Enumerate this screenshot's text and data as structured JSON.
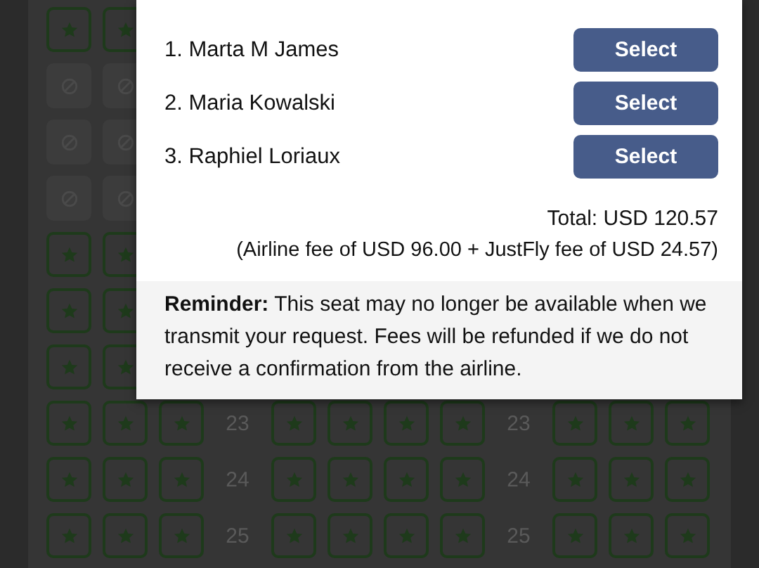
{
  "seat_rows": [
    {
      "available": true
    },
    {
      "available": false
    },
    {
      "available": false
    },
    {
      "available": false
    },
    {
      "available": true
    },
    {
      "available": true
    },
    {
      "available": true
    },
    {
      "available": true,
      "numbers": [
        "23",
        "23"
      ]
    },
    {
      "available": true,
      "numbers": [
        "24",
        "24"
      ]
    },
    {
      "available": true,
      "numbers": [
        "25",
        "25"
      ]
    }
  ],
  "dialog": {
    "passengers": [
      {
        "name": "1. Marta M James",
        "button": "Select"
      },
      {
        "name": "2. Maria Kowalski",
        "button": "Select"
      },
      {
        "name": "3. Raphiel Loriaux",
        "button": "Select"
      }
    ],
    "total": "Total: USD 120.57",
    "fee_breakdown": "(Airline fee of USD 96.00 + JustFly fee of USD 24.57)",
    "reminder": "**Reminder:** This seat may no longer be available when we transmit your request. Fees will be refunded if we do not receive a confirmation from the airline."
  }
}
